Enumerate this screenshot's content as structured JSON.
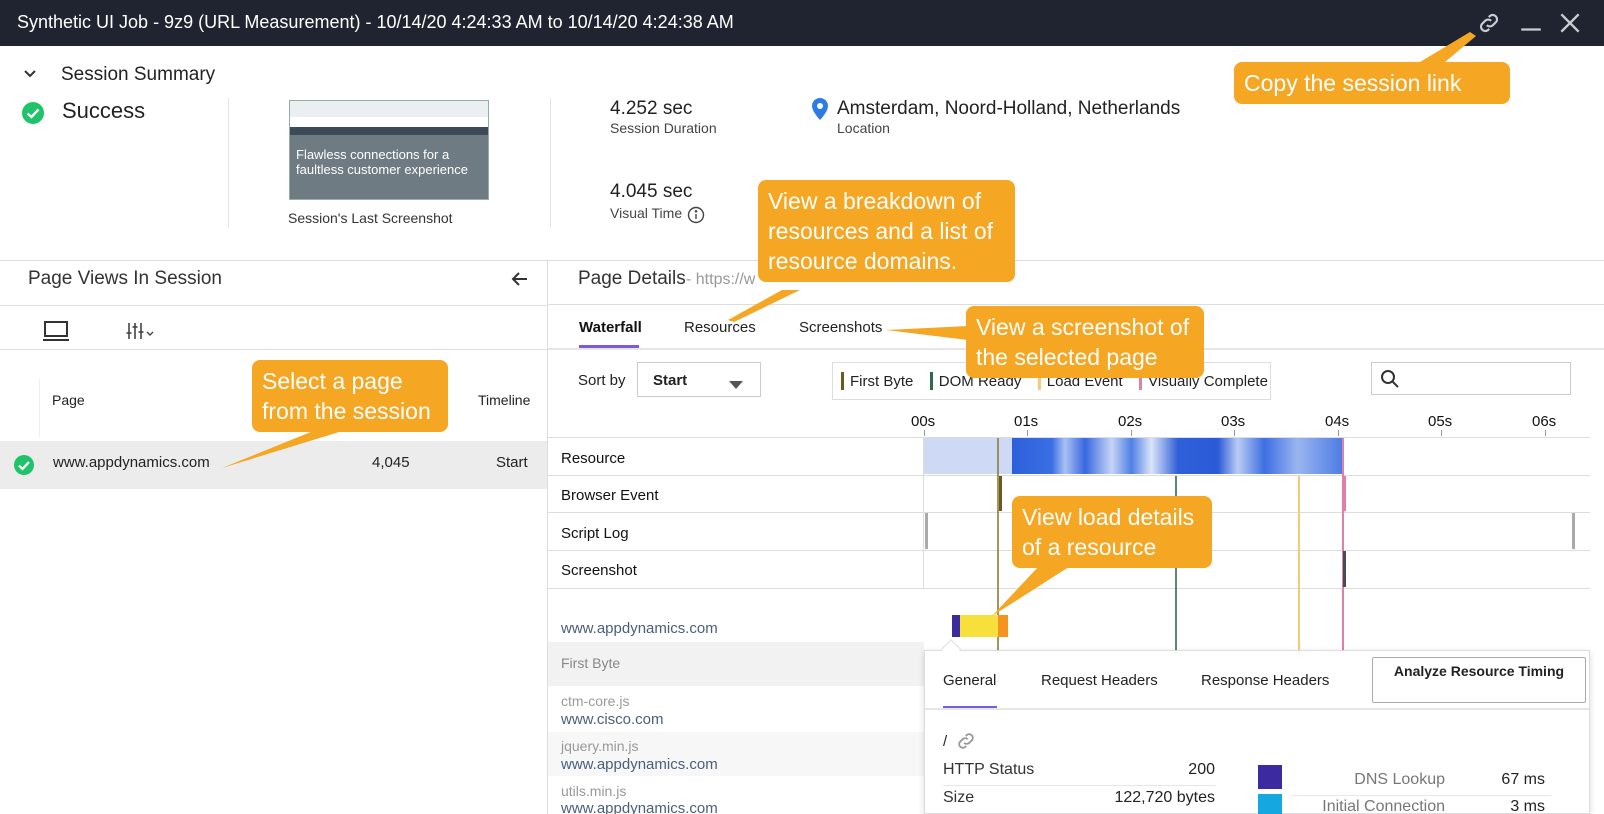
{
  "window": {
    "title": "Synthetic UI Job - 9z9 (URL Measurement) - 10/14/20 4:24:33 AM to 10/14/20 4:24:38 AM"
  },
  "summary": {
    "heading": "Session Summary",
    "status": "Success",
    "screenshot_caption": "Session's Last Screenshot",
    "screenshot_text": "Flawless connections for a faultless customer experience",
    "duration_value": "4.252 sec",
    "duration_label": "Session Duration",
    "visual_value": "4.045 sec",
    "visual_label": "Visual Time",
    "location_value": "Amsterdam, Noord-Holland, Netherlands",
    "location_label": "Location"
  },
  "page_views": {
    "title": "Page Views In Session",
    "col_page": "Page",
    "col_timeline": "Timeline",
    "rows": [
      {
        "page": "www.appdynamics.com",
        "value": "4,045",
        "timeline": "Start"
      }
    ]
  },
  "page_details": {
    "title": "Page Details",
    "url": "- https://w",
    "tabs": [
      "Waterfall",
      "Resources",
      "Screenshots"
    ],
    "sort_label": "Sort by",
    "sort_value": "Start",
    "legend": [
      {
        "label": "First Byte",
        "color": "#6b5b1e"
      },
      {
        "label": "DOM Ready",
        "color": "#2f6b4a"
      },
      {
        "label": "Load Event",
        "color": "#f7c97a"
      },
      {
        "label": "Visually Complete",
        "color": "#e07fa8"
      }
    ],
    "ticks": [
      "00s",
      "01s",
      "02s",
      "03s",
      "04s",
      "05s",
      "06s"
    ],
    "rows": [
      "Resource",
      "Browser Event",
      "Script Log",
      "Screenshot"
    ],
    "resource_domain": "www.appdynamics.com",
    "first_byte": "First Byte",
    "resources": [
      {
        "file": "ctm-core.js",
        "domain": "www.cisco.com"
      },
      {
        "file": "jquery.min.js",
        "domain": "www.appdynamics.com"
      },
      {
        "file": "utils.min.js",
        "domain": "www.appdynamics.com"
      }
    ]
  },
  "popup": {
    "tabs": [
      "General",
      "Request Headers",
      "Response Headers"
    ],
    "analyze_button": "Analyze Resource Timing",
    "path": "/",
    "http_status_label": "HTTP Status",
    "http_status_value": "200",
    "size_label": "Size",
    "size_value": "122,720 bytes",
    "dns_label": "DNS Lookup",
    "dns_value": "67 ms",
    "init_conn_label": "Initial Connection",
    "init_conn_value": "3 ms",
    "dns_color": "#3b2aa0",
    "init_conn_color": "#14a7e0"
  },
  "callouts": {
    "copy_link": "Copy the session link",
    "breakdown": "View a breakdown of resources and a list of resource domains.",
    "screenshot": "View a screenshot of the selected page",
    "select_page": "Select a page from the session",
    "load_details": "View load details of a resource"
  },
  "colors": {
    "accent": "#7b5cd6",
    "callout": "#f5a623",
    "success": "#1fc46a",
    "titlebar": "#1f2430"
  }
}
